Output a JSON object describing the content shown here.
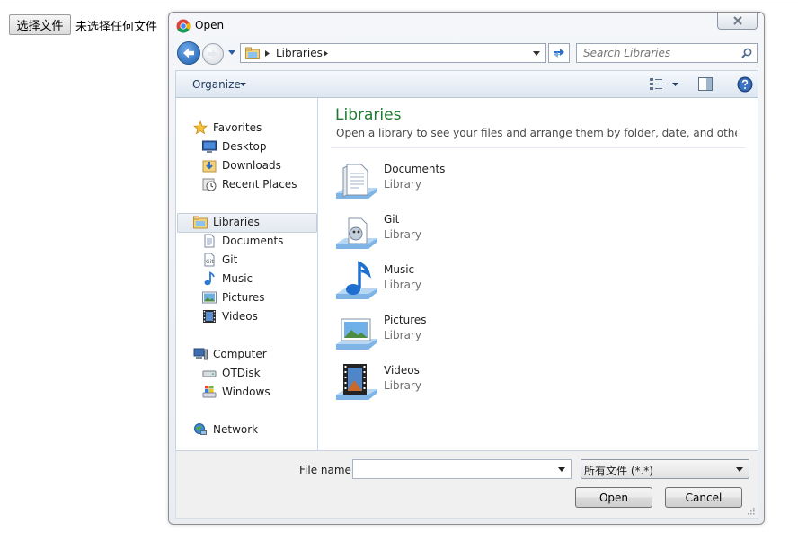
{
  "page": {
    "choose_file_button": "选择文件",
    "no_file_chosen": "未选择任何文件"
  },
  "dialog": {
    "title": "Open",
    "address": {
      "location": "Libraries"
    },
    "search": {
      "placeholder": "Search Libraries"
    },
    "toolbar": {
      "organize_label": "Organize"
    },
    "nav": {
      "favorites": {
        "label": "Favorites",
        "items": [
          "Desktop",
          "Downloads",
          "Recent Places"
        ]
      },
      "libraries": {
        "label": "Libraries",
        "items": [
          "Documents",
          "Git",
          "Music",
          "Pictures",
          "Videos"
        ]
      },
      "computer": {
        "label": "Computer",
        "items": [
          "OTDisk",
          "Windows"
        ]
      },
      "network": {
        "label": "Network"
      }
    },
    "content": {
      "title": "Libraries",
      "description": "Open a library to see your files and arrange them by folder, date, and other proper...",
      "items": [
        {
          "name": "Documents",
          "type": "Library"
        },
        {
          "name": "Git",
          "type": "Library"
        },
        {
          "name": "Music",
          "type": "Library"
        },
        {
          "name": "Pictures",
          "type": "Library"
        },
        {
          "name": "Videos",
          "type": "Library"
        }
      ]
    },
    "footer": {
      "file_name_label": "File name:",
      "file_name_value": "",
      "file_type_value": "所有文件 (*.*)",
      "open_label": "Open",
      "cancel_label": "Cancel"
    }
  },
  "colors": {
    "content_title": "#1e7a2f",
    "organize_text": "#1e395b",
    "selection_bg": "#e3e9f0"
  }
}
